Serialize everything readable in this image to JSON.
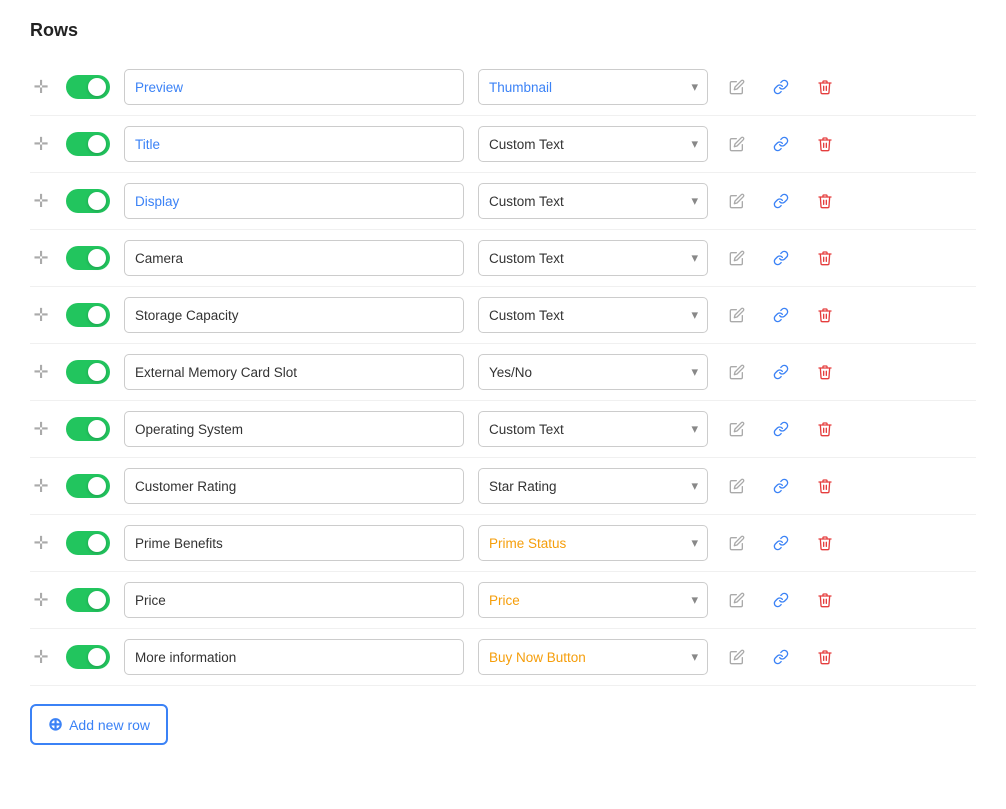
{
  "heading": "Rows",
  "rows": [
    {
      "id": 1,
      "label": "Preview",
      "label_blue": true,
      "type": "Thumbnail",
      "type_colored": "thumbnail"
    },
    {
      "id": 2,
      "label": "Title",
      "label_blue": true,
      "type": "Custom Text",
      "type_colored": "none"
    },
    {
      "id": 3,
      "label": "Display",
      "label_blue": true,
      "type": "Custom Text",
      "type_colored": "none"
    },
    {
      "id": 4,
      "label": "Camera",
      "label_blue": false,
      "type": "Custom Text",
      "type_colored": "none"
    },
    {
      "id": 5,
      "label": "Storage Capacity",
      "label_blue": false,
      "type": "Custom Text",
      "type_colored": "none"
    },
    {
      "id": 6,
      "label": "External Memory Card Slot",
      "label_blue": false,
      "type": "Yes/No",
      "type_colored": "none"
    },
    {
      "id": 7,
      "label": "Operating System",
      "label_blue": false,
      "type": "Custom Text",
      "type_colored": "none"
    },
    {
      "id": 8,
      "label": "Customer Rating",
      "label_blue": false,
      "type": "Star Rating",
      "type_colored": "none"
    },
    {
      "id": 9,
      "label": "Prime Benefits",
      "label_blue": false,
      "type": "Prime Status",
      "type_colored": "orange"
    },
    {
      "id": 10,
      "label": "Price",
      "label_blue": false,
      "type": "Price",
      "type_colored": "orange"
    },
    {
      "id": 11,
      "label": "More information",
      "label_blue": false,
      "type": "Buy Now Button",
      "type_colored": "orange"
    }
  ],
  "add_row_label": "Add new row",
  "type_options": [
    "Custom Text",
    "Thumbnail",
    "Yes/No",
    "Star Rating",
    "Prime Status",
    "Price",
    "Buy Now Button"
  ]
}
